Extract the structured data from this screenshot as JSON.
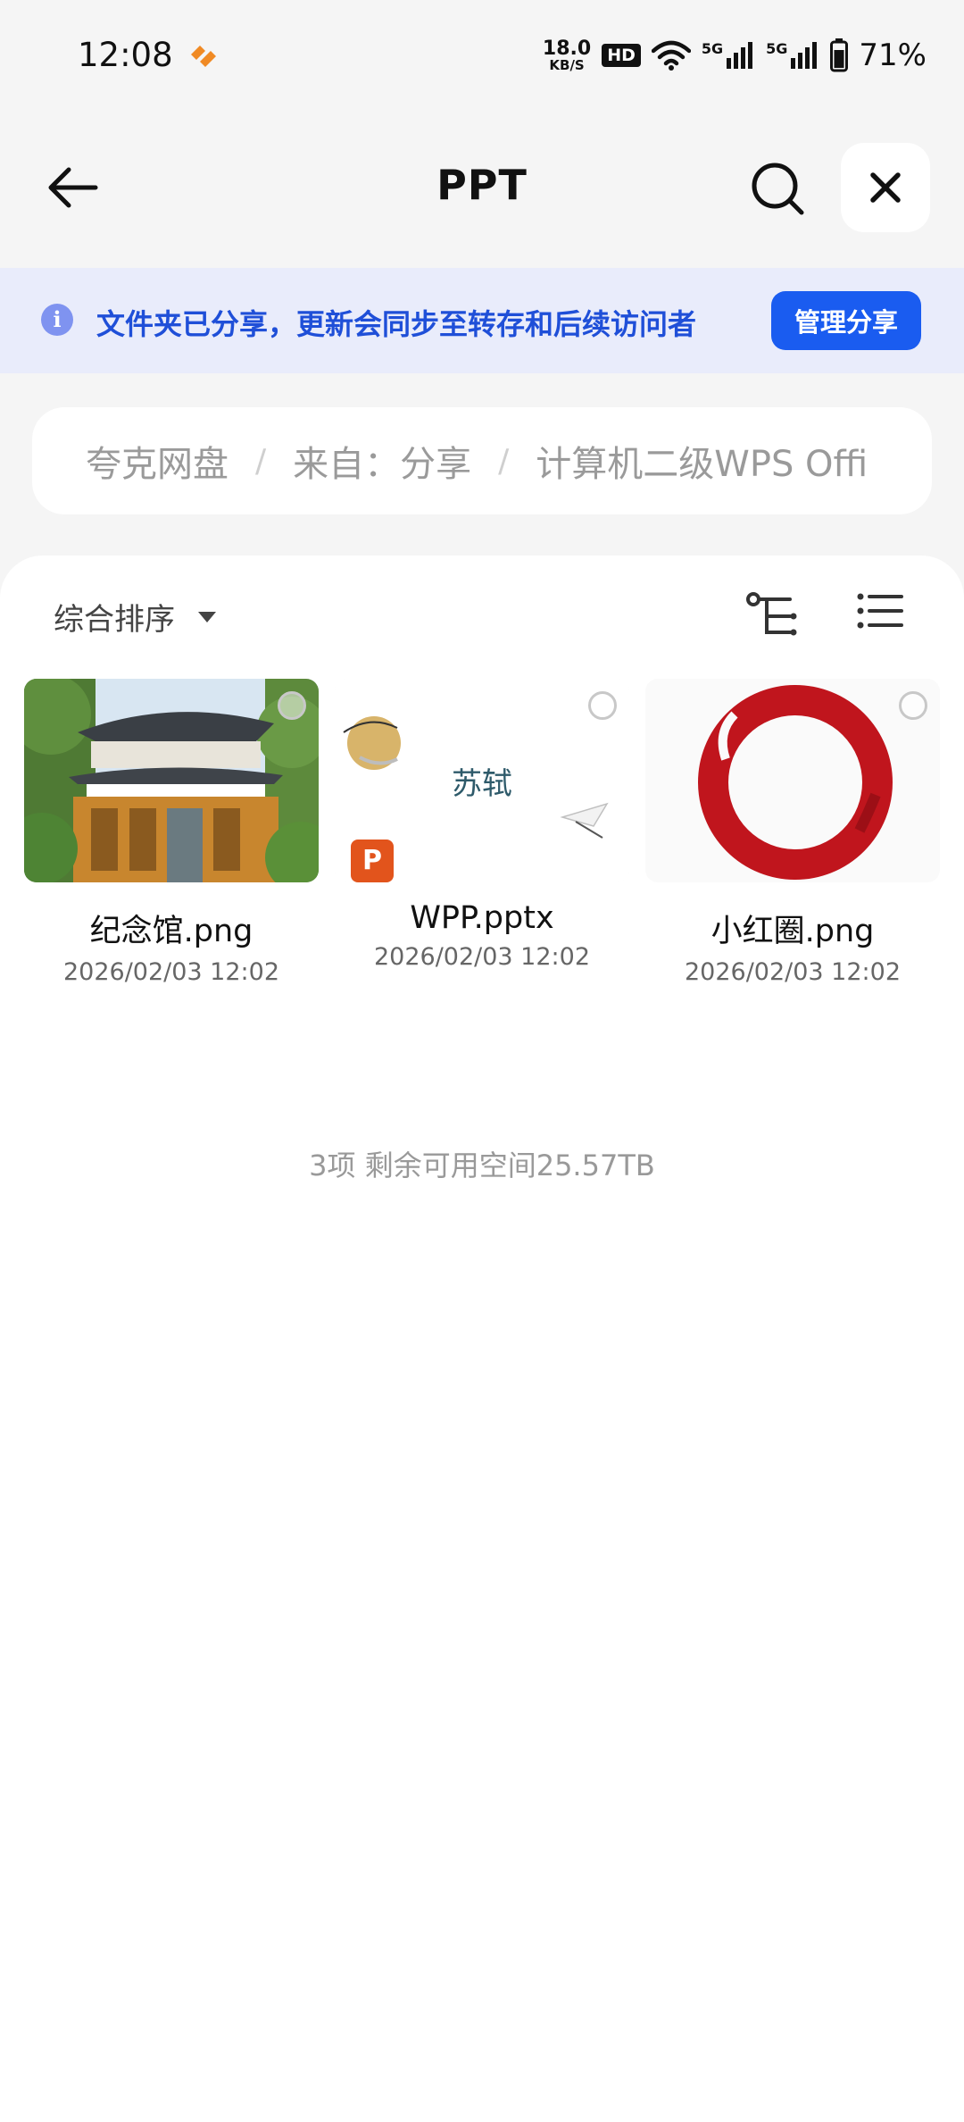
{
  "status_bar": {
    "time": "12:08",
    "net_speed_value": "18.0",
    "net_speed_unit": "KB/S",
    "hd_badge": "HD",
    "signal_label_1": "5G",
    "signal_label_2": "5G",
    "battery": "71%"
  },
  "nav": {
    "title": "PPT",
    "back_icon": "arrow-left-icon",
    "search_icon": "search-icon",
    "close_icon": "close-icon"
  },
  "share_banner": {
    "text": "文件夹已分享，更新会同步至转存和后续访问者",
    "button": "管理分享",
    "accent": "#1a5cf0"
  },
  "breadcrumb": {
    "items": [
      "夸克网盘",
      "来自：分享",
      "计算机二级WPS Offi"
    ]
  },
  "toolbar": {
    "sort_label": "综合排序"
  },
  "files": [
    {
      "name": "纪念馆.png",
      "date": "2026/02/03 12:02",
      "type": "image"
    },
    {
      "name": "WPP.pptx",
      "date": "2026/02/03 12:02",
      "type": "pptx",
      "thumb_text": "苏轼",
      "badge": "P"
    },
    {
      "name": "小红圈.png",
      "date": "2026/02/03 12:02",
      "type": "image"
    }
  ],
  "footer": {
    "summary": "3项 剩余可用空间25.57TB"
  }
}
